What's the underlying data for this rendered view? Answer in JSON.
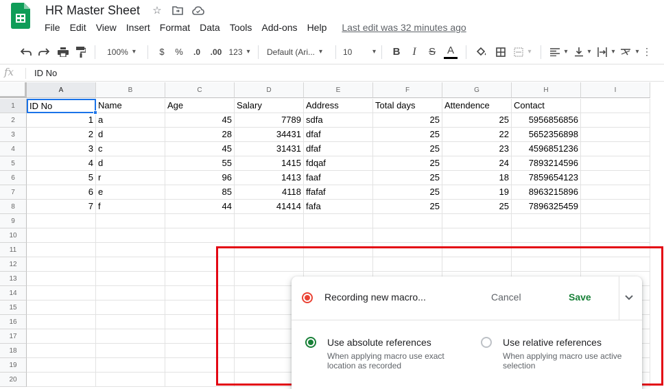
{
  "app": {
    "title": "HR Master Sheet",
    "menu": [
      "File",
      "Edit",
      "View",
      "Insert",
      "Format",
      "Data",
      "Tools",
      "Add-ons",
      "Help"
    ],
    "last_edit": "Last edit was 32 minutes ago",
    "brand_color": "#0f9d58"
  },
  "toolbar": {
    "zoom": "100%",
    "currency": "$",
    "percent": "%",
    "dec_less": ".0",
    "dec_more": ".00",
    "format_more": "123",
    "font": "Default (Ari...",
    "font_size": "10",
    "bold": "B",
    "italic": "I",
    "strike": "S",
    "text_color": "A"
  },
  "formula_bar": {
    "fx": "fx",
    "value": "ID No"
  },
  "sheet": {
    "columns": [
      "A",
      "B",
      "C",
      "D",
      "E",
      "F",
      "G",
      "H",
      "I"
    ],
    "rows": [
      "1",
      "2",
      "3",
      "4",
      "5",
      "6",
      "7",
      "8",
      "9",
      "10",
      "11",
      "12",
      "13",
      "14",
      "15",
      "16",
      "17",
      "18",
      "19",
      "20"
    ],
    "headers": [
      "ID No",
      "Name",
      "Age",
      "Salary",
      "Address",
      "Total days",
      "Attendence",
      "Contact"
    ],
    "data": [
      [
        "1",
        "a",
        "45",
        "7789",
        "sdfa",
        "25",
        "25",
        "5956856856"
      ],
      [
        "2",
        "d",
        "28",
        "34431",
        "dfaf",
        "25",
        "22",
        "5652356898"
      ],
      [
        "3",
        "c",
        "45",
        "31431",
        "dfaf",
        "25",
        "23",
        "4596851236"
      ],
      [
        "4",
        "d",
        "55",
        "1415",
        "fdqaf",
        "25",
        "24",
        "7893214596"
      ],
      [
        "5",
        "r",
        "96",
        "1413",
        "faaf",
        "25",
        "18",
        "7859654123"
      ],
      [
        "6",
        "e",
        "85",
        "4118",
        "ffafaf",
        "25",
        "19",
        "8963215896"
      ],
      [
        "7",
        "f",
        "44",
        "41414",
        "fafa",
        "25",
        "25",
        "7896325459"
      ]
    ]
  },
  "macro_panel": {
    "recording_label": "Recording new macro...",
    "cancel": "Cancel",
    "save": "Save",
    "absolute_title": "Use absolute references",
    "absolute_desc": "When applying macro use exact location as recorded",
    "relative_title": "Use relative references",
    "relative_desc": "When applying macro use active selection",
    "selected": "absolute"
  }
}
